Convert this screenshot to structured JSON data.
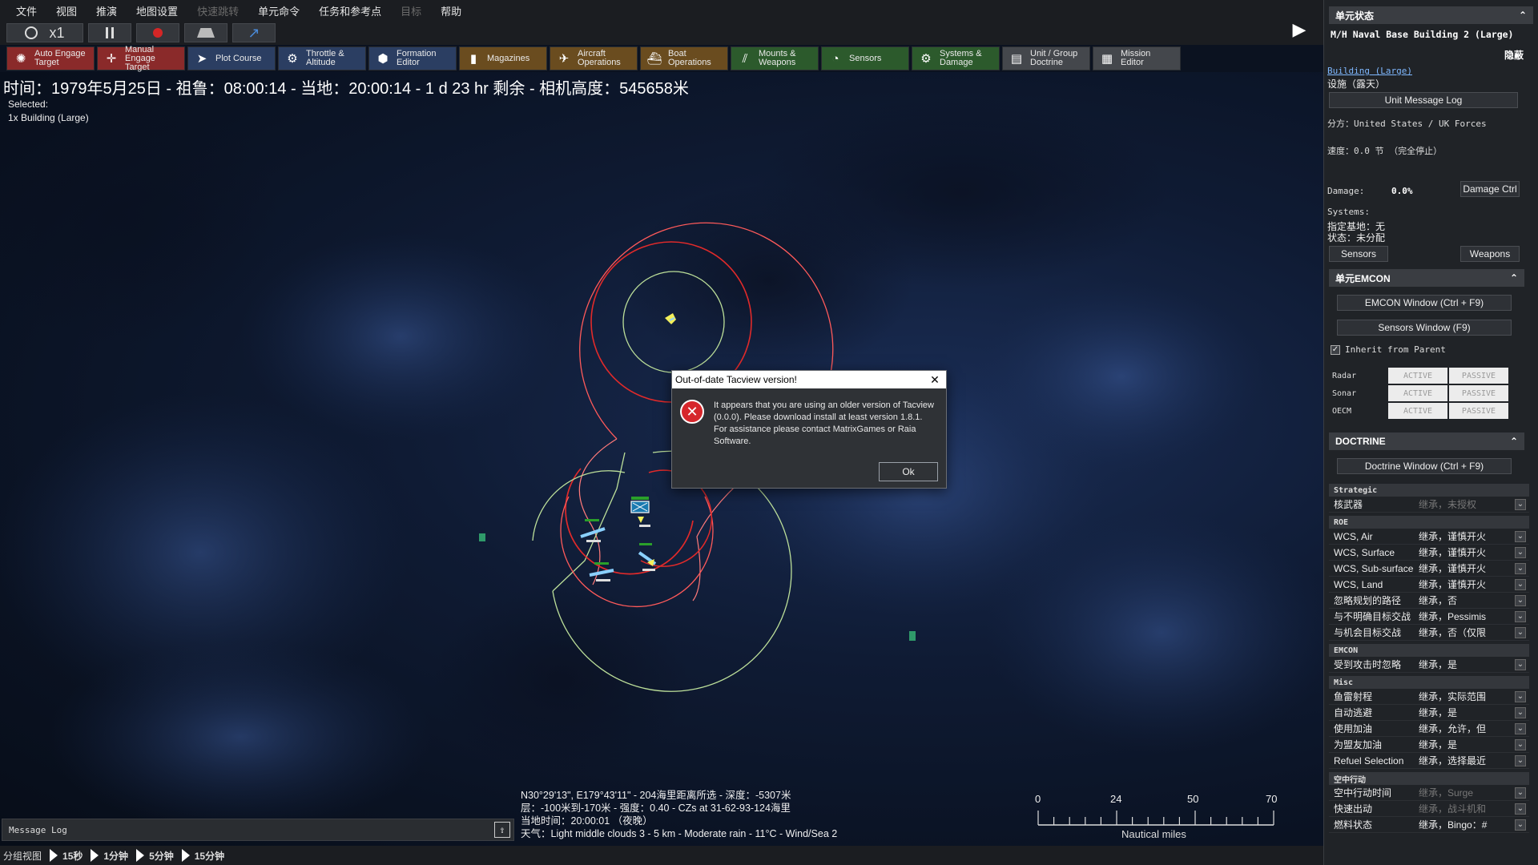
{
  "menu": {
    "items": [
      {
        "label": "文件",
        "disabled": false
      },
      {
        "label": "视图",
        "disabled": false
      },
      {
        "label": "推演",
        "disabled": false
      },
      {
        "label": "地图设置",
        "disabled": false
      },
      {
        "label": "快速跳转",
        "disabled": true
      },
      {
        "label": "单元命令",
        "disabled": false
      },
      {
        "label": "任务和参考点",
        "disabled": false
      },
      {
        "label": "目标",
        "disabled": true
      },
      {
        "label": "帮助",
        "disabled": false
      }
    ]
  },
  "time_controls": {
    "clock_icon": "clock-icon",
    "speed": "x1",
    "pause_icon": "pause-icon",
    "record_icon": "record-icon",
    "step_icon": "step-icon",
    "jump_icon": "jump-icon"
  },
  "toolbar": [
    {
      "l1": "Auto Engage",
      "l2": "Target",
      "color": "#8a2a2a",
      "icon": "target-icon"
    },
    {
      "l1": "Manual",
      "l2": "Engage Target",
      "color": "#8a2a2a",
      "icon": "crosshair-icon"
    },
    {
      "l1": "Plot Course",
      "l2": "",
      "color": "#2b3e62",
      "icon": "course-icon"
    },
    {
      "l1": "Throttle &",
      "l2": "Altitude",
      "color": "#2b3e62",
      "icon": "throttle-icon"
    },
    {
      "l1": "Formation",
      "l2": "Editor",
      "color": "#2b3e62",
      "icon": "formation-icon"
    },
    {
      "l1": "Magazines",
      "l2": "",
      "color": "#6a4c1f",
      "icon": "magazine-icon"
    },
    {
      "l1": "Aircraft",
      "l2": "Operations",
      "color": "#6a4c1f",
      "icon": "aircraft-icon"
    },
    {
      "l1": "Boat",
      "l2": "Operations",
      "color": "#6a4c1f",
      "icon": "boat-icon"
    },
    {
      "l1": "Mounts &",
      "l2": "Weapons",
      "color": "#2c5a2c",
      "icon": "mounts-icon"
    },
    {
      "l1": "Sensors",
      "l2": "",
      "color": "#2c5a2c",
      "icon": "sensors-icon"
    },
    {
      "l1": "Systems &",
      "l2": "Damage",
      "color": "#2c5a2c",
      "icon": "gear-icon"
    },
    {
      "l1": "Unit / Group",
      "l2": "Doctrine",
      "color": "#44474c",
      "icon": "doctrine-icon"
    },
    {
      "l1": "Mission",
      "l2": "Editor",
      "color": "#44474c",
      "icon": "mission-icon"
    }
  ],
  "map": {
    "timeline": "时间：1979年5月25日 - 祖鲁：08:00:14 - 当地：20:00:14 - 1 d 23 hr 剩余 - 相机高度：545658米",
    "selected_title": "Selected:",
    "selected_unit": "1x Building (Large)",
    "coords_lines": [
      "N30°29'13\", E179°43'11\" - 204海里距离所选 - 深度：-5307米",
      "层：-100米到-170米 - 强度：0.40 - CZs at 31-62-93-124海里",
      "当地时间：20:00:01 （夜晚）",
      "天气：Light middle clouds 3 - 5 km - Moderate rain - 11°C - Wind/Sea 2"
    ],
    "scale_labels": [
      "0",
      "24",
      "50",
      "70"
    ],
    "scale_unit": "Nautical miles"
  },
  "message_log": {
    "label": "Message Log",
    "button_icon": "expand-icon"
  },
  "bottom": {
    "group_view": "分组视图",
    "speeds": [
      "15秒",
      "1分钟",
      "5分钟",
      "15分钟"
    ]
  },
  "panel": {
    "unit_status_header": "单元状态",
    "unit_name": "M/H Naval Base Building 2 (Large)",
    "hostility": "隐蔽",
    "class_link": "Building (Large)",
    "type": "设施（露天）",
    "message_log_btn": "Unit Message Log",
    "side": "分方：United States / UK Forces",
    "speed": "速度：0.0 节 （完全停止）",
    "damage_label": "Damage:",
    "damage_value": "0.0%",
    "damage_btn": "Damage Ctrl",
    "systems_label": "Systems:",
    "base_line": "指定基地：无",
    "status_line": "状态：未分配",
    "sensors_btn": "Sensors",
    "weapons_btn": "Weapons",
    "emcon_header": "单元EMCON",
    "emcon_window_btn": "EMCON Window (Ctrl + F9)",
    "sensors_window_btn": "Sensors Window (F9)",
    "inherit_label": "Inherit from Parent",
    "emcon_rows": [
      {
        "name": "Radar",
        "a": "ACTIVE",
        "p": "PASSIVE"
      },
      {
        "name": "Sonar",
        "a": "ACTIVE",
        "p": "PASSIVE"
      },
      {
        "name": "OECM",
        "a": "ACTIVE",
        "p": "PASSIVE"
      }
    ],
    "doctrine_header": "DOCTRINE",
    "doctrine_window_btn": "Doctrine Window (Ctrl + F9)",
    "strategic_label": "Strategic",
    "nuclear_label": "核武器",
    "nuclear_value": "继承，未授权",
    "roe_label": "ROE",
    "roe_rows": [
      {
        "k": "WCS, Air",
        "v": "继承，谨慎开火"
      },
      {
        "k": "WCS, Surface",
        "v": "继承，谨慎开火"
      },
      {
        "k": "WCS, Sub-surface",
        "v": "继承，谨慎开火"
      },
      {
        "k": "WCS, Land",
        "v": "继承，谨慎开火"
      },
      {
        "k": "忽略规划的路径",
        "v": "继承，否"
      },
      {
        "k": "与不明确目标交战",
        "v": "继承，Pessimis"
      },
      {
        "k": "与机会目标交战",
        "v": "继承，否（仅限"
      }
    ],
    "emcon_sub_label": "EMCON",
    "emcon_sub_rows": [
      {
        "k": "受到攻击时忽略",
        "v": "继承，是"
      }
    ],
    "misc_label": "Misc",
    "misc_rows": [
      {
        "k": "鱼雷射程",
        "v": "继承，实际范围"
      },
      {
        "k": "自动逃避",
        "v": "继承，是"
      },
      {
        "k": "使用加油",
        "v": "继承，允许，但"
      },
      {
        "k": "为盟友加油",
        "v": "继承，是"
      },
      {
        "k": "Refuel Selection",
        "v": "继承，选择最近"
      }
    ],
    "air_ops_label": "空中行动",
    "air_rows": [
      {
        "k": "空中行动时间",
        "v": "继承，Surge",
        "dim": true
      },
      {
        "k": "快速出动",
        "v": "继承，战斗机和",
        "dim": true
      },
      {
        "k": "燃料状态",
        "v": "继承，Bingo：#",
        "dim": false
      }
    ]
  },
  "dialog": {
    "title": "Out-of-date Tacview version!",
    "close_icon": "close-icon",
    "error_icon": "error-icon",
    "message": "It appears that you are using an older version of Tacview (0.0.0). Please download  install at least version 1.8.1. For assistance please contact MatrixGames or Raia Software.",
    "ok_label": "Ok"
  }
}
